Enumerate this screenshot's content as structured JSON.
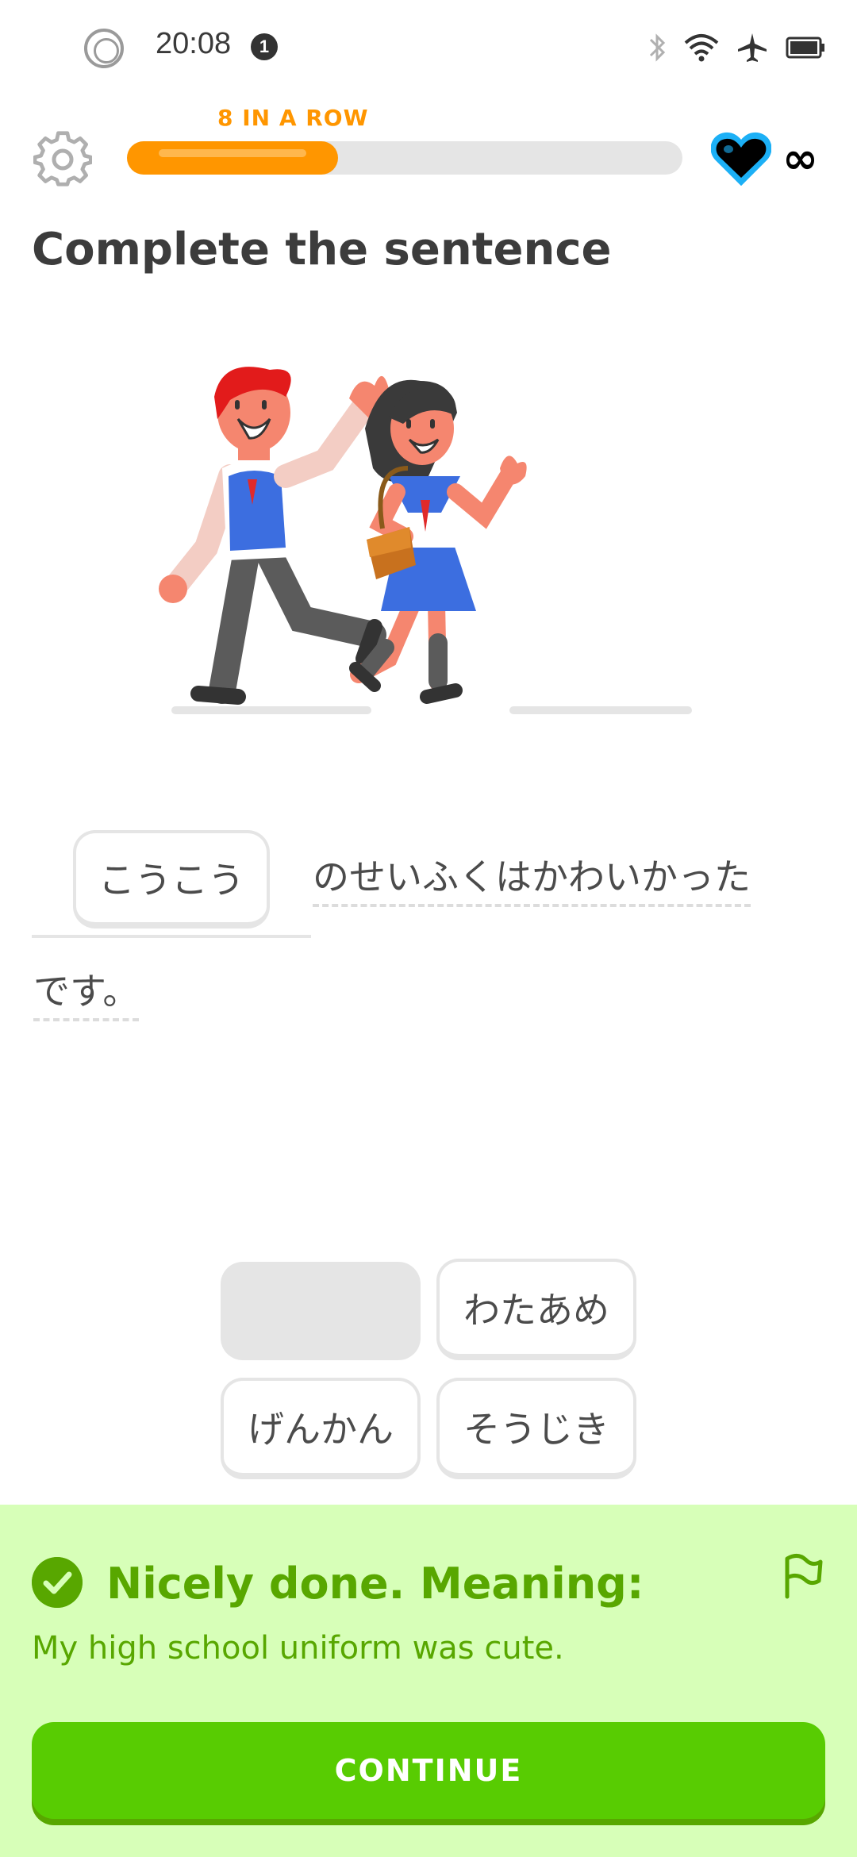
{
  "status_bar": {
    "time": "20:08",
    "notification_count": "1",
    "icons": [
      "bluetooth-icon",
      "wifi-icon",
      "airplane-mode-icon",
      "battery-icon"
    ]
  },
  "header": {
    "streak_label": "8 IN A ROW",
    "progress_fraction": 0.38,
    "hearts_label": "∞"
  },
  "exercise": {
    "title": "Complete the sentence",
    "selected_word": "こうこう",
    "sentence_part_1": "のせいふくはかわいかった",
    "sentence_part_2": "です。"
  },
  "word_bank": {
    "words": [
      "わたあめ",
      "げんかん",
      "そうじき"
    ],
    "used_slot": "こうこう"
  },
  "feedback": {
    "title": "Nicely done. Meaning:",
    "meaning": "My high school uniform was cute.",
    "continue_label": "CONTINUE"
  },
  "colors": {
    "accent_orange": "#ff9600",
    "success_green": "#58cc02",
    "success_dark": "#58a700",
    "panel_bg": "#d7ffb8",
    "border_gray": "#e5e5e5"
  }
}
